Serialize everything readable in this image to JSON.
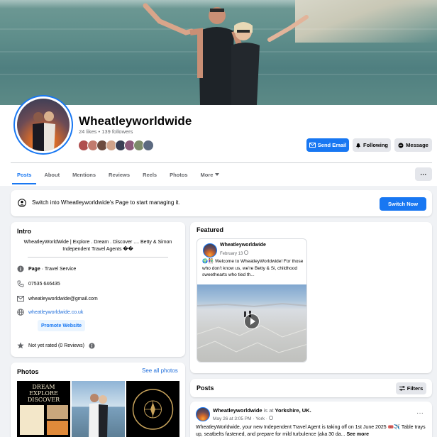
{
  "page": {
    "name": "Wheatleyworldwide",
    "stats": "24 likes • 139 followers"
  },
  "actions": {
    "send_email": "Send Email",
    "following": "Following",
    "message": "Message",
    "more": "···"
  },
  "tabs": [
    "Posts",
    "About",
    "Mentions",
    "Reviews",
    "Reels",
    "Photos",
    "More"
  ],
  "switch_bar": {
    "text": "Switch into Wheatleyworldwide's Page to start managing it.",
    "button": "Switch Now"
  },
  "intro": {
    "title": "Intro",
    "bio": "WheatleyWorldWide | Explore . Dream . Discover .... Betty & Simon Independent Travel Agents ��",
    "category_bold": "Page",
    "category_rest": " · Travel Service",
    "phone": "07535 646435",
    "email": "wheatleyworldwide@gmail.com",
    "website": "wheatleyworldwide.co.uk",
    "promote": "Promote Website",
    "rating": "Not yet rated (0 Reviews)"
  },
  "featured": {
    "title": "Featured",
    "author": "Wheatleyworldwide",
    "date": "February 13",
    "text": "🌍👫 Welcome to WheatleyWorldwide! For those who don't know us, we're Betty & Si, childhood sweethearts who tied th..."
  },
  "photos": {
    "title": "Photos",
    "see_all": "See all photos",
    "thumb1_lines": [
      "DREAM",
      "EXPLORE",
      "DISCOVER"
    ]
  },
  "posts": {
    "title": "Posts",
    "filters": "Filters",
    "author": "Wheatleyworldwide",
    "is_at": " is at ",
    "location": "Yorkshire, UK.",
    "meta": "May 26 at 3:05 PM · York ·",
    "body": "WheatleyWorldwide, your new Independent Travel Agent is taking off on 1st June 2025 🎟️✈️ Table trays up, seatbelts fastened, and prepare for mild turbulence (aka 30 da...",
    "see_more": "See more"
  }
}
